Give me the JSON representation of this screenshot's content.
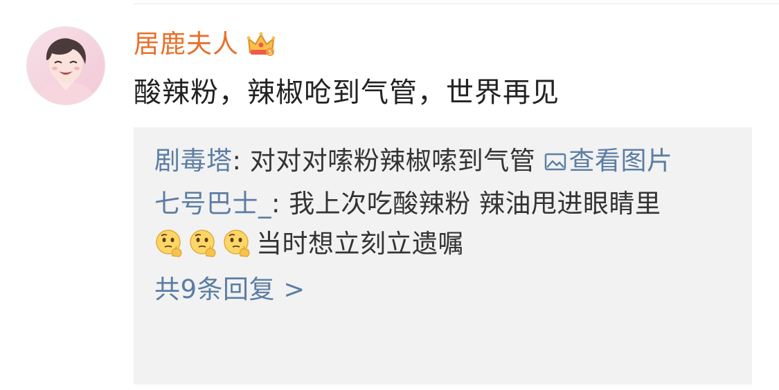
{
  "comment": {
    "username": "居鹿夫人",
    "badge_icon": "crown-vip-icon",
    "text": "酸辣粉，辣椒呛到气管，世界再见"
  },
  "replies": {
    "items": [
      {
        "author": "剧毒塔",
        "separator": ": ",
        "text": "对对对嗦粉辣椒嗦到气管 ",
        "link_icon": "image-icon",
        "link_text": "查看图片"
      },
      {
        "author": "七号巴士_",
        "separator": ": ",
        "text_before": "我上次吃酸辣粉 辣油甩进眼睛里",
        "emoji_icon": "thinking-face-emoji",
        "emoji_count": 3,
        "text_after": "当时想立刻立遗嘱"
      }
    ],
    "more_label": "共9条回复 >"
  },
  "colors": {
    "username": "#e8702a",
    "link": "#5b7da3",
    "reply_bg": "#f2f2f2",
    "text": "#222222"
  }
}
